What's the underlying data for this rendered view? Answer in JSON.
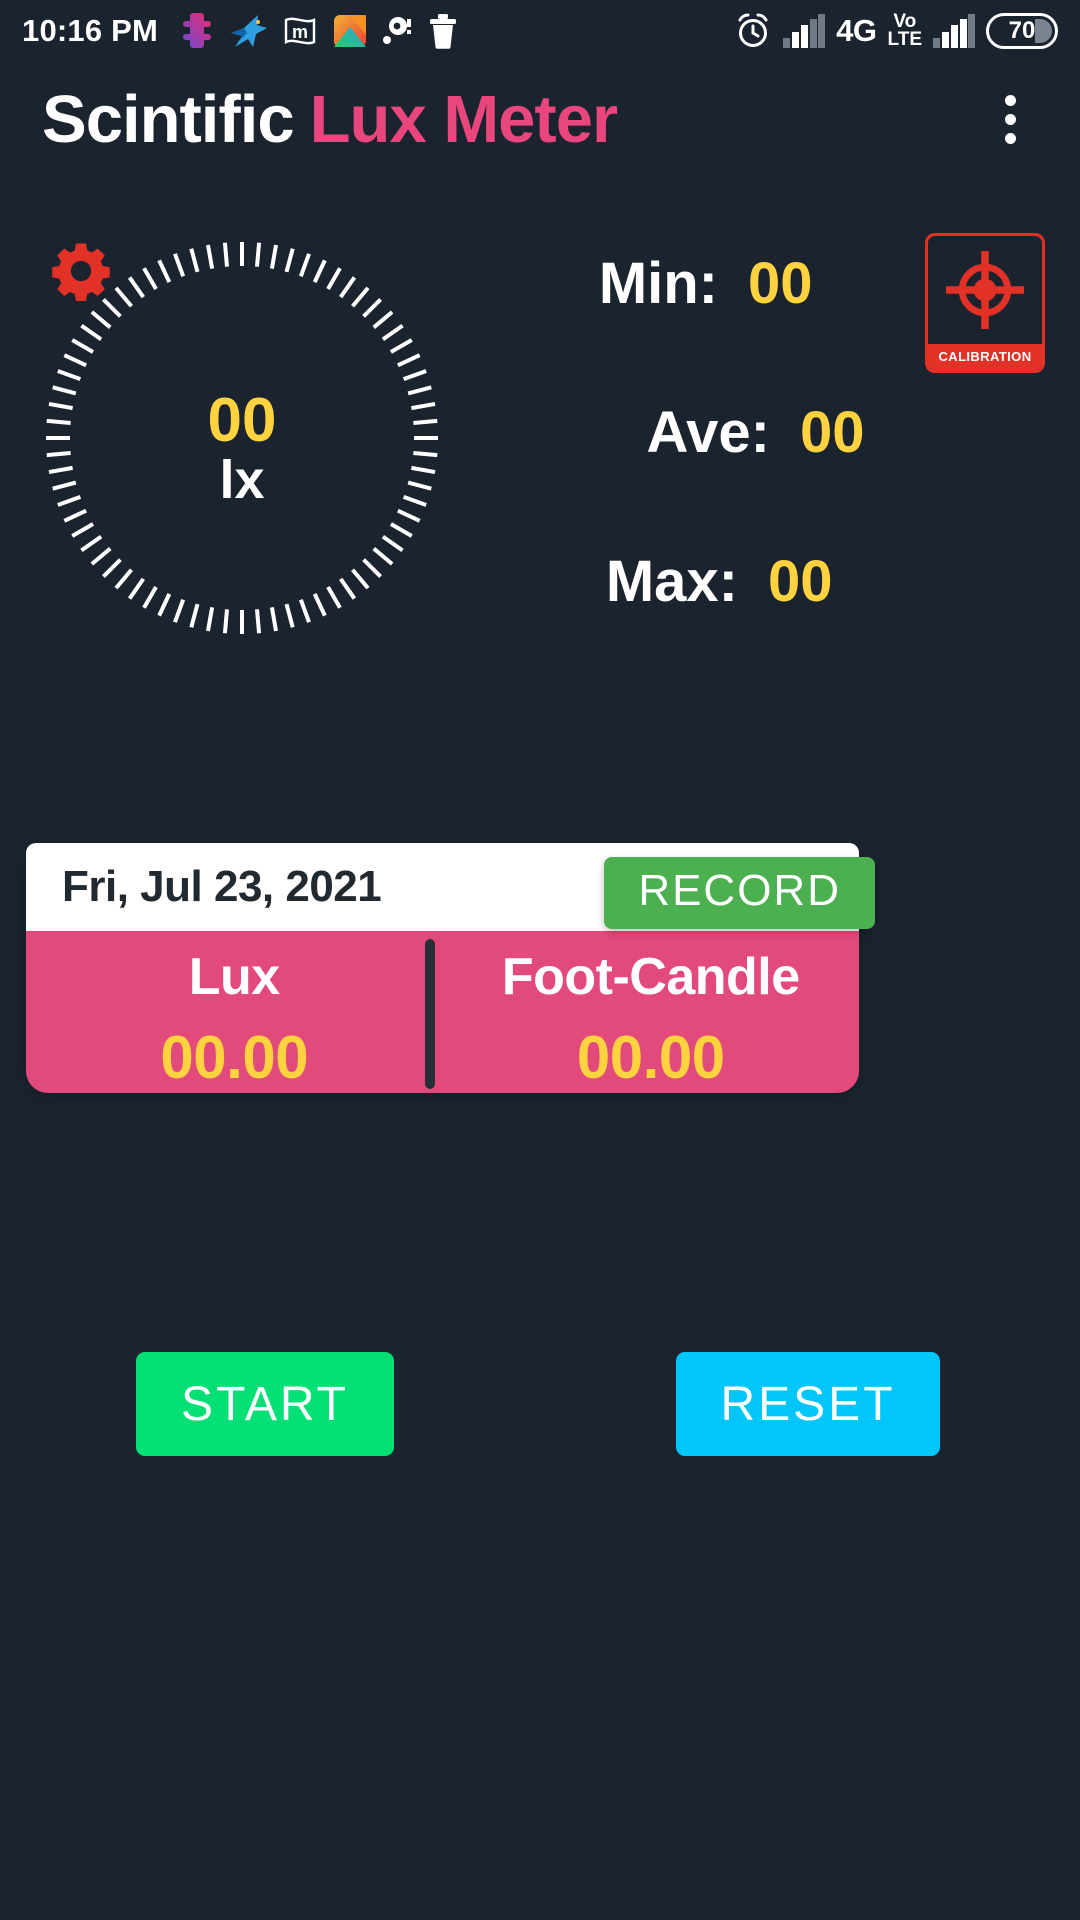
{
  "status_bar": {
    "clock": "10:16 PM",
    "notifications": [
      {
        "icon": "puzzle-piece-icon"
      },
      {
        "icon": "hummingbird-icon"
      },
      {
        "icon": "m-flag-icon"
      },
      {
        "icon": "gallery-icon"
      },
      {
        "icon": "recorder-dot-icon"
      },
      {
        "icon": "trash-icon"
      }
    ],
    "alarm_icon": "alarm-clock-icon",
    "signal_1_icon": "signal-bars-icon",
    "network": "4G",
    "volte_top": "Vo",
    "volte_bottom": "LTE",
    "signal_2_icon": "signal-bars-icon",
    "battery_level": "70"
  },
  "app_bar": {
    "title_part1": "Scintific",
    "title_part2": "Lux Meter",
    "overflow_icon": "more-vertical-icon"
  },
  "controls": {
    "settings_icon": "gear-icon",
    "calibration_icon": "crosshair-target-icon",
    "calibration_label": "CALIBRATION"
  },
  "gauge": {
    "value": "00",
    "unit": "lx",
    "tick_count": 72
  },
  "stats": [
    {
      "label": "Min:",
      "value": "00"
    },
    {
      "label": "Ave:",
      "value": "00"
    },
    {
      "label": "Max:",
      "value": "00"
    }
  ],
  "record_card": {
    "date": "Fri, Jul 23, 2021",
    "record_button": "RECORD",
    "readings": [
      {
        "label": "Lux",
        "value": "00.00"
      },
      {
        "label": "Foot-Candle",
        "value": "00.00"
      }
    ]
  },
  "actions": {
    "start": "START",
    "reset": "RESET"
  },
  "colors": {
    "background": "#1b242e",
    "accent_pink": "#e8467c",
    "card_pink": "#e24a7c",
    "value_yellow": "#ffd23f",
    "red": "#e23127",
    "green_record": "#4caf50",
    "green_start": "#05e076",
    "cyan_reset": "#00c6fb",
    "white": "#ffffff"
  }
}
